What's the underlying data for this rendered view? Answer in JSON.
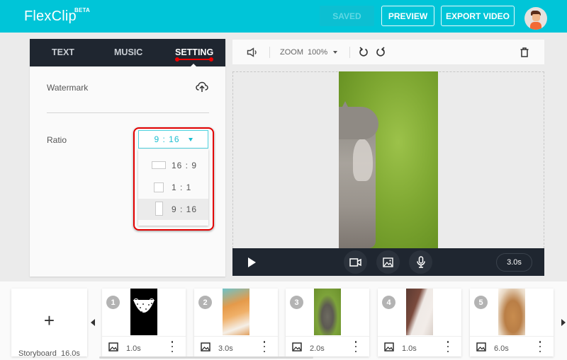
{
  "header": {
    "logo": "FlexClip",
    "beta_badge": "BETA",
    "saved_label": "SAVED",
    "preview_label": "PREVIEW",
    "export_label": "EXPORT VIDEO",
    "brand_color": "#00c5d8"
  },
  "left_panel": {
    "tabs": [
      {
        "label": "TEXT",
        "active": false
      },
      {
        "label": "MUSIC",
        "active": false
      },
      {
        "label": "SETTING",
        "active": true
      }
    ],
    "watermark_label": "Watermark",
    "ratio_label": "Ratio",
    "ratio_selected": "9 : 16",
    "ratio_options": [
      {
        "label": "16 : 9",
        "selected": false
      },
      {
        "label": "1 : 1",
        "selected": false
      },
      {
        "label": "9 : 16",
        "selected": true
      }
    ]
  },
  "preview_toolbar": {
    "zoom_label": "ZOOM",
    "zoom_value": "100%"
  },
  "preview_controls": {
    "duration": "3.0s"
  },
  "storyboard": {
    "label": "Storyboard",
    "total_duration": "16.0s",
    "clips": [
      {
        "number": "1",
        "duration": "1.0s"
      },
      {
        "number": "2",
        "duration": "3.0s"
      },
      {
        "number": "3",
        "duration": "2.0s"
      },
      {
        "number": "4",
        "duration": "1.0s"
      },
      {
        "number": "5",
        "duration": "6.0s"
      }
    ]
  }
}
